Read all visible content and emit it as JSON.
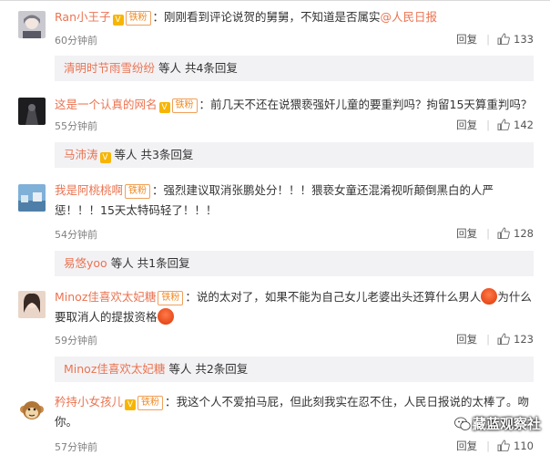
{
  "comments": [
    {
      "name": "Ran小王子",
      "badge": "铁粉",
      "text": "：刚刚看到评论说贺的舅舅，不知道是否属实",
      "mention": "@人民日报",
      "time": "60分钟前",
      "reply_label": "回复",
      "likes": "133",
      "sub_who": "清明时节雨雪纷纷",
      "sub_tail": "等人 共4条回复"
    },
    {
      "name": "这是一个认真的网名",
      "badge": "铁粉",
      "text": "：前几天不还在说猥亵强奸儿童的要重判吗？拘留15天算重判吗？",
      "time": "55分钟前",
      "reply_label": "回复",
      "likes": "142",
      "sub_who": "马沛涛",
      "sub_tail": "等人 共3条回复"
    },
    {
      "name": "我是阿桃桃啊",
      "badge": "铁粉",
      "text": "：强烈建议取消张鹏处分！！！猥亵女童还混淆视听颠倒黑白的人严惩！！！15天太特码轻了！！！",
      "time": "54分钟前",
      "reply_label": "回复",
      "likes": "128",
      "sub_who": "易悠yoo",
      "sub_tail": "等人 共1条回复"
    },
    {
      "name": "Minoz佳喜欢太妃糖",
      "badge": "铁粉",
      "text_a": "：说的太对了，如果不能为自己女儿老婆出头还算什么男人",
      "text_b": "为什么要取消人的提拔资格",
      "time": "59分钟前",
      "reply_label": "回复",
      "likes": "123",
      "sub_who": "Minoz佳喜欢太妃糖",
      "sub_tail": "等人 共2条回复"
    },
    {
      "name": "矜持小女孩儿",
      "badge": "铁粉",
      "text": "：我这个人不爱拍马屁，但此刻我实在忍不住，人民日报说的太棒了。吻你。",
      "time": "57分钟前",
      "reply_label": "回复",
      "likes": "110"
    }
  ],
  "watermark": "藏蓝观察社",
  "colors": {
    "name": "#eb7350",
    "badge": "#f08a24",
    "subbox_bg": "#f2f2f5"
  }
}
